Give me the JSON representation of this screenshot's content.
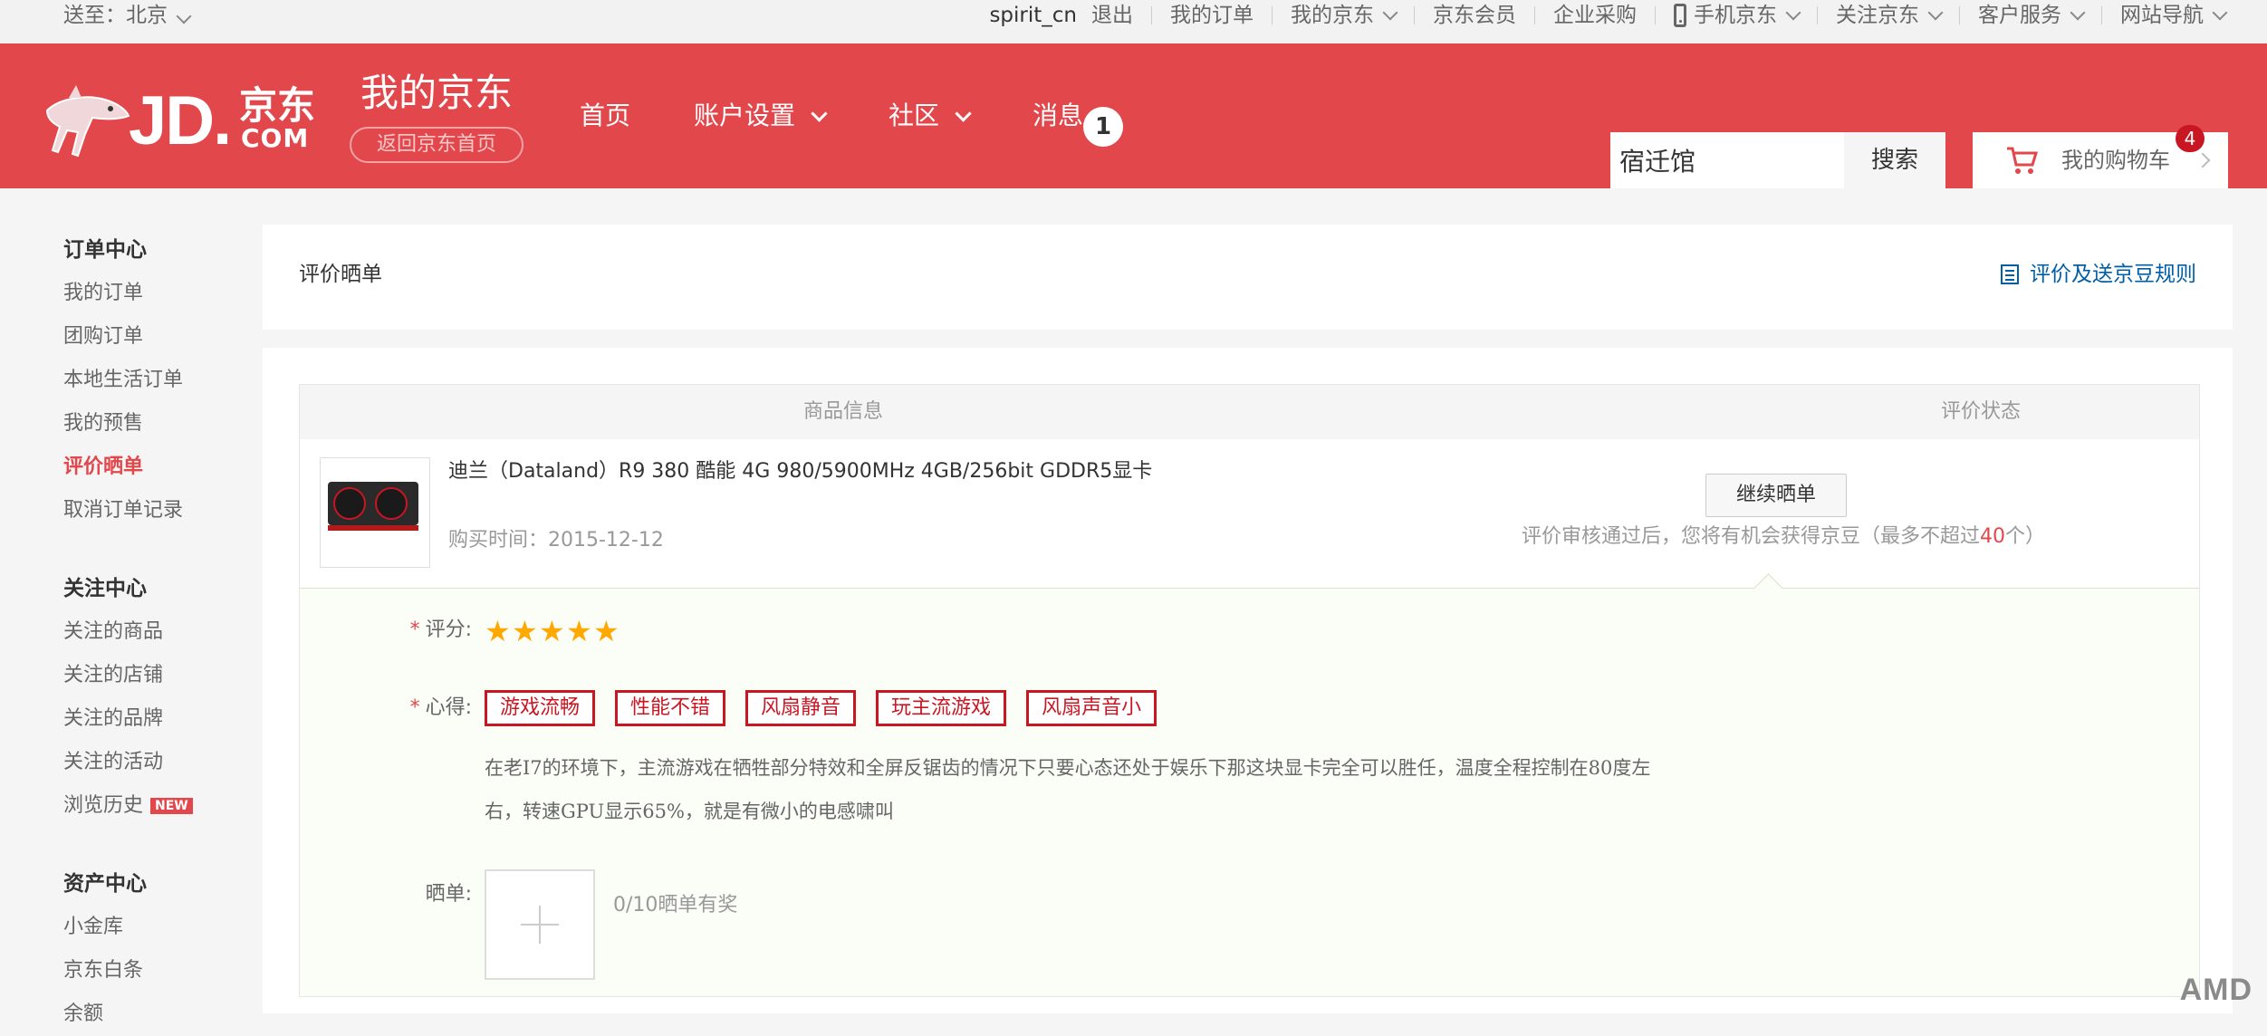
{
  "topbar": {
    "location_label": "送至：北京",
    "user": "spirit_cn",
    "logout": "退出",
    "links": [
      "我的订单",
      "我的京东",
      "京东会员",
      "企业采购",
      "手机京东",
      "关注京东",
      "客户服务",
      "网站导航"
    ]
  },
  "header": {
    "logo_jd": "JD.",
    "logo_cn": "京东",
    "logo_com": "COM",
    "title": "我的京东",
    "back_home": "返回京东首页",
    "nav": [
      "首页",
      "账户设置",
      "社区",
      "消息"
    ],
    "message_count": "1",
    "search_value": "宿迁馆",
    "search_button": "搜索",
    "cart_label": "我的购物车",
    "cart_count": "4"
  },
  "sidebar": {
    "groups": [
      {
        "title": "订单中心",
        "items": [
          "我的订单",
          "团购订单",
          "本地生活订单",
          "我的预售",
          "评价晒单",
          "取消订单记录"
        ]
      },
      {
        "title": "关注中心",
        "items": [
          "关注的商品",
          "关注的店铺",
          "关注的品牌",
          "关注的活动",
          "浏览历史"
        ]
      },
      {
        "title": "资产中心",
        "items": [
          "小金库",
          "京东白条",
          "余额"
        ]
      }
    ],
    "new_tag": "NEW",
    "active_item": "评价晒单"
  },
  "page": {
    "title": "评价晒单",
    "rules_link": "评价及送京豆规则"
  },
  "table": {
    "col_product": "商品信息",
    "col_status": "评价状态",
    "product_name": "迪兰（Dataland）R9 380 酷能 4G 980/5900MHz 4GB/256bit GDDR5显卡",
    "purchase_time": "购买时间：2015-12-12",
    "continue_button": "继续晒单",
    "reward_prefix": "评价审核通过后，您将有机会获得京豆（最多不超过",
    "reward_num": "40",
    "reward_suffix": "个）"
  },
  "review": {
    "score_label": "评分:",
    "rating": 5,
    "insight_label": "心得:",
    "tags": [
      "游戏流畅",
      "性能不错",
      "风扇静音",
      "玩主流游戏",
      "风扇声音小"
    ],
    "text_line1": "在老I7的环境下，主流游戏在牺牲部分特效和全屏反锯齿的情况下只要心态还处于娱乐下那这块显卡完全可以胜任，温度全程控制在80度左",
    "text_line2": "右，转速GPU显示65%，就是有微小的电感啸叫",
    "show_label": "晒单:",
    "upload_note": "0/10晒单有奖"
  },
  "watermark": "AMD",
  "colors": {
    "brand_red": "#e2474b",
    "link_blue": "#005ea7",
    "star": "#ffa800"
  }
}
